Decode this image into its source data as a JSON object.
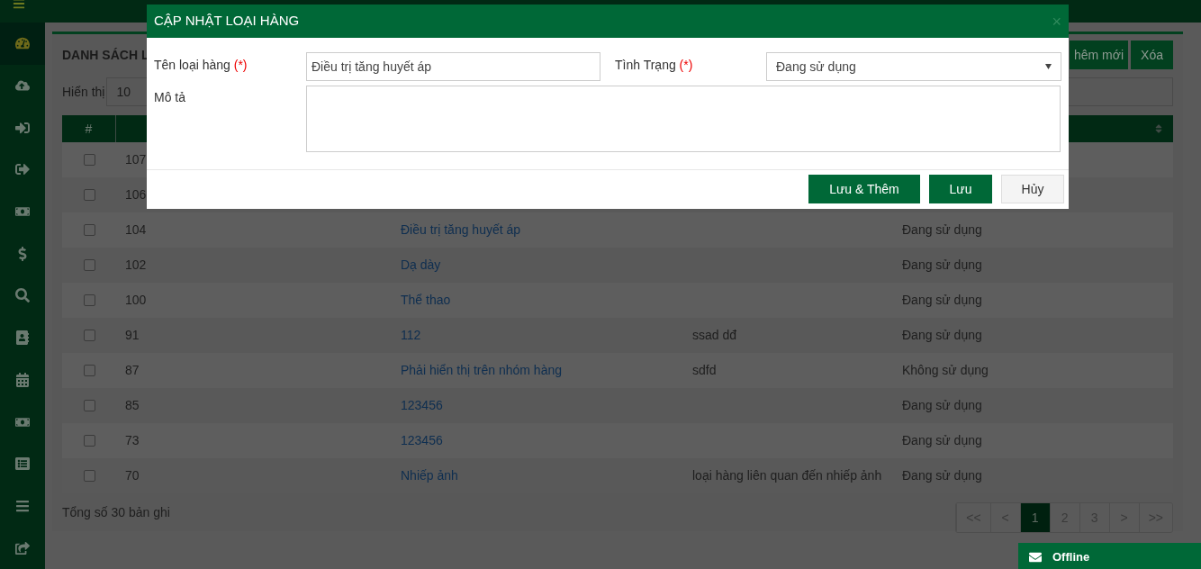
{
  "page": {
    "title": "DANH SÁCH L",
    "show_label": "Hiển thị",
    "page_size": "10",
    "add_button": "hêm mới",
    "delete_button": "Xóa"
  },
  "table": {
    "columns": [
      "#"
    ],
    "rows": [
      {
        "checked": false,
        "id": "107"
      },
      {
        "checked": false,
        "id": "106"
      },
      {
        "checked": false,
        "id": "104",
        "name": "Điều trị tăng huyết áp",
        "status": "Đang sử dụng"
      },
      {
        "checked": false,
        "id": "102",
        "name": "Dạ dày",
        "status": "Đang sử dụng"
      },
      {
        "checked": false,
        "id": "100",
        "name": "Thể thao",
        "status": "Đang sử dụng"
      },
      {
        "checked": false,
        "id": "91",
        "name": "112",
        "description": "ssad dđ",
        "status": "Đang sử dụng"
      },
      {
        "checked": false,
        "id": "87",
        "name": "Phải hiển thị trên nhóm hàng",
        "description": "sdfd",
        "status": "Không sử dụng"
      },
      {
        "checked": false,
        "id": "85",
        "name": "123456",
        "status": "Đang sử dụng"
      },
      {
        "checked": false,
        "id": "73",
        "name": "123456",
        "status": "Đang sử dụng"
      },
      {
        "checked": false,
        "id": "70",
        "name": "Nhiếp ảnh",
        "description": "loại hàng liên quan đến nhiếp ảnh",
        "status": "Đang sử dụng"
      }
    ]
  },
  "total": "Tổng số 30 bản ghi",
  "pagination": [
    {
      "label": "<<",
      "selected": false
    },
    {
      "label": "<",
      "selected": false
    },
    {
      "label": "1",
      "selected": true
    },
    {
      "label": "2",
      "selected": false
    },
    {
      "label": "3",
      "selected": false
    },
    {
      "label": ">",
      "selected": false
    },
    {
      "label": ">>",
      "selected": false
    }
  ],
  "chat": {
    "label": "Offline"
  },
  "dialog": {
    "title": "CẬP NHẬT LOẠI HÀNG",
    "close": "×",
    "name_label": "Tên loại hàng",
    "required_mark": "(*)",
    "name_value": "Điều trị tăng huyết áp",
    "status_label": "Tình Trạng",
    "status_required_mark": "(*)",
    "status_value": "Đang sử dụng",
    "description_label": "Mô tả",
    "buttons": [
      {
        "label": "Lưu & Thêm",
        "kind": "primary"
      },
      {
        "label": "Lưu",
        "kind": "primary"
      },
      {
        "label": "Hủy",
        "kind": "secondary"
      }
    ]
  }
}
